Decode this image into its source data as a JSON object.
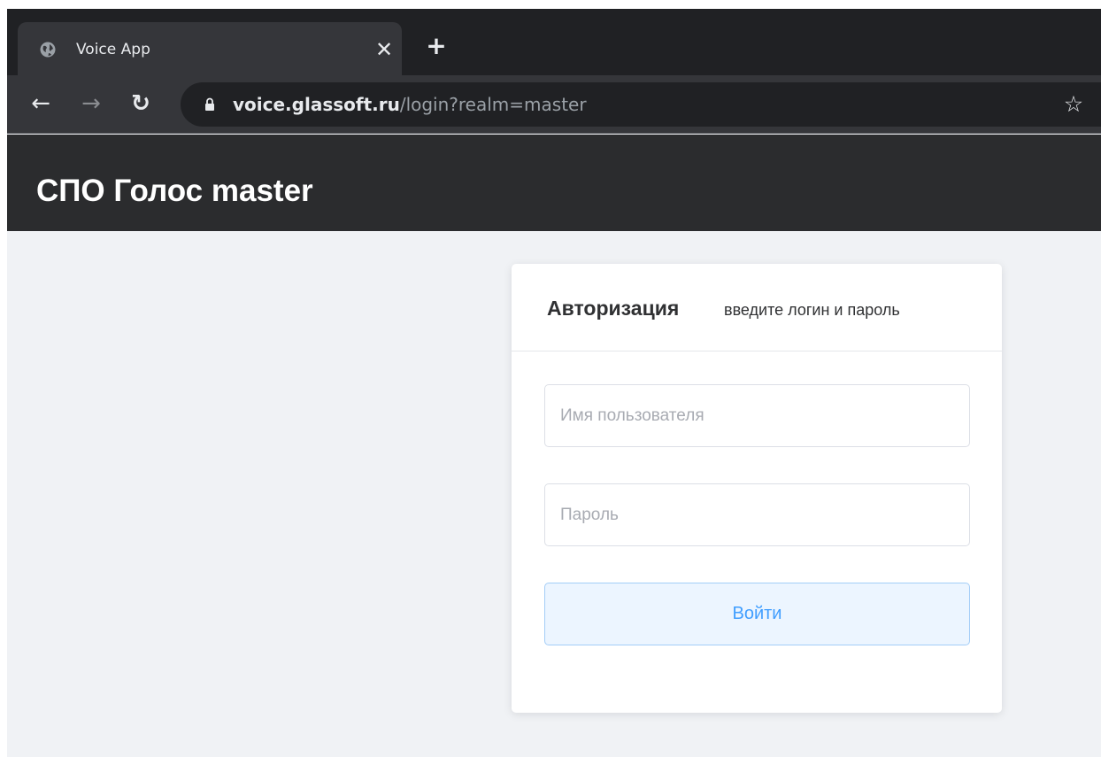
{
  "browser": {
    "tab": {
      "title": "Voice App",
      "close_glyph": "✕",
      "favicon": "globe-icon"
    },
    "new_tab_glyph": "+",
    "nav": {
      "back_glyph": "←",
      "forward_glyph": "→",
      "reload_glyph": "↻"
    },
    "address": {
      "host": "voice.glassoft.ru",
      "path": "/login?realm=master"
    },
    "star_glyph": "☆"
  },
  "header": {
    "title": "СПО Голос master"
  },
  "login": {
    "title": "Авторизация",
    "subtitle": "введите логин и пароль",
    "username": {
      "placeholder": "Имя пользователя",
      "value": ""
    },
    "password": {
      "placeholder": "Пароль",
      "value": ""
    },
    "submit_label": "Войти"
  },
  "colors": {
    "page_bg": "#f0f2f5",
    "header_bg": "#2b2c2e",
    "accent": "#409eff",
    "button_bg": "#ecf5ff"
  }
}
